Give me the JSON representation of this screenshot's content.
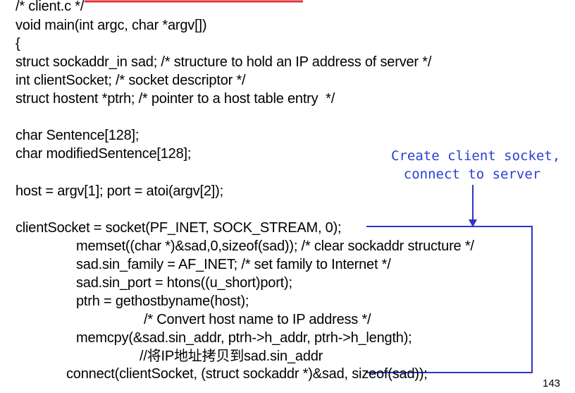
{
  "code": {
    "lines": [
      "/* client.c */",
      "void main(int argc, char *argv[])",
      "{",
      "struct sockaddr_in sad; /* structure to hold an IP address of server */",
      "int clientSocket; /* socket descriptor */",
      "struct hostent *ptrh; /* pointer to a host table entry  */",
      "char Sentence[128];",
      "char modifiedSentence[128];",
      "host = argv[1]; port = atoi(argv[2]);",
      "clientSocket = socket(PF_INET, SOCK_STREAM, 0);",
      "memset((char *)&sad,0,sizeof(sad)); /* clear sockaddr structure */",
      "sad.sin_family = AF_INET; /* set family to Internet */",
      "sad.sin_port = htons((u_short)port);",
      "ptrh = gethostbyname(host);",
      "/* Convert host name to IP address */",
      "memcpy(&sad.sin_addr, ptrh->h_addr, ptrh->h_length);",
      "//将IP地址拷贝到sad.sin_addr",
      "connect(clientSocket, (struct sockaddr *)&sad, sizeof(sad));"
    ]
  },
  "annotation": {
    "line1": "Create client socket,",
    "line2": "connect to server"
  },
  "page_number": "143",
  "colors": {
    "annotation": "#2b3fd4",
    "box": "#2f35c9",
    "top_accent": "#e0323c"
  }
}
